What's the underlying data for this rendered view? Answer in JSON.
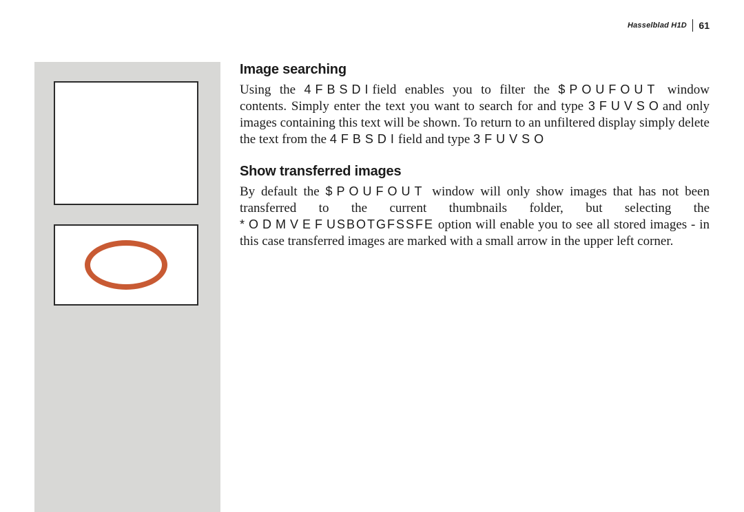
{
  "header": {
    "model": "Hasselblad H1D",
    "page": "61"
  },
  "sections": [
    {
      "heading": "Image searching",
      "body_html": "Using the <span class='spaced'>4FBSDI</span>field enables you to filter the <span class='spaced'>$POUFOUT</span> window contents. Simply enter the text you want to search for and type <span class='spaced'>3FUVSO</span>and only images containing this text will be shown. To return to an unfiltered display simply delete the text from the <span class='spaced'>4FBSDI</span>field and type <span class='spaced'>3FUVSO</span>"
    },
    {
      "heading": "Show transferred images",
      "body_html": "By default the <span class='spaced'>$POUFOUT</span> window will only show images that has not been transferred to the current thumbnails folder, but selecting the <span class='spaced'>*ODMVEF</span><span class='spaced-narrow'>USBOTGFSSFE</span> option will enable you to see all stored images - in this case transferred images are marked with a small arrow in the upper left corner."
    }
  ]
}
